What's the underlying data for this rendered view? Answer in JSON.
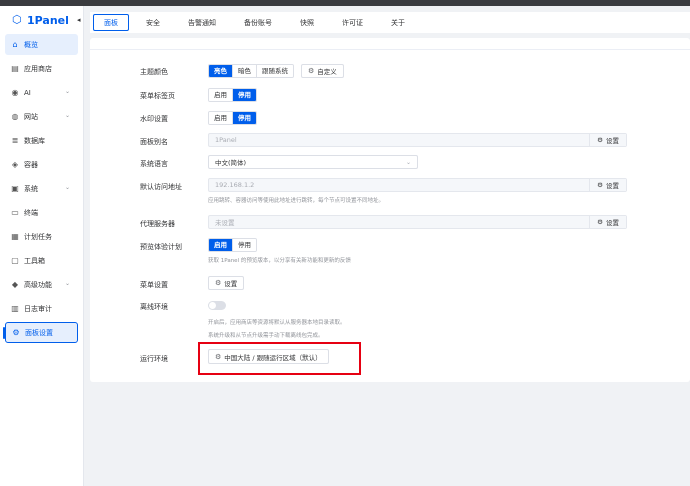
{
  "sidebar": {
    "brand": "1Panel",
    "items": [
      {
        "label": "概览",
        "icon": "home-icon",
        "expandable": false
      },
      {
        "label": "应用商店",
        "icon": "store-icon",
        "expandable": false
      },
      {
        "label": "AI",
        "icon": "robot-icon",
        "expandable": true
      },
      {
        "label": "网站",
        "icon": "globe-icon",
        "expandable": true
      },
      {
        "label": "数据库",
        "icon": "database-icon",
        "expandable": false
      },
      {
        "label": "容器",
        "icon": "container-icon",
        "expandable": false
      },
      {
        "label": "系统",
        "icon": "system-icon",
        "expandable": true
      },
      {
        "label": "终端",
        "icon": "terminal-icon",
        "expandable": false
      },
      {
        "label": "计划任务",
        "icon": "calendar-icon",
        "expandable": false
      },
      {
        "label": "工具箱",
        "icon": "toolbox-icon",
        "expandable": false
      },
      {
        "label": "高级功能",
        "icon": "diamond-icon",
        "expandable": true
      },
      {
        "label": "日志审计",
        "icon": "log-icon",
        "expandable": false
      },
      {
        "label": "面板设置",
        "icon": "gear-icon",
        "expandable": false
      }
    ]
  },
  "tabs": [
    "面板",
    "安全",
    "告警通知",
    "备份账号",
    "快照",
    "许可证",
    "关于"
  ],
  "settings": {
    "theme": {
      "label": "主题颜色",
      "options": [
        "亮色",
        "暗色",
        "跟随系统"
      ],
      "selected": "亮色",
      "custom_button": "自定义"
    },
    "menu_tab": {
      "label": "菜单标签页",
      "options": [
        "启用",
        "停用"
      ],
      "selected": "停用"
    },
    "watermark": {
      "label": "水印设置",
      "options": [
        "启用",
        "停用"
      ],
      "selected": "停用"
    },
    "panel_alias": {
      "label": "面板别名",
      "value": "1Panel",
      "button": "设置"
    },
    "language": {
      "label": "系统语言",
      "value": "中文(简体)"
    },
    "default_address": {
      "label": "默认访问地址",
      "value": "192.168.1.2",
      "button": "设置",
      "hint": "应用跳转、容器访问等使用此地址进行跳转，每个节点可设置不同地址。"
    },
    "proxy": {
      "label": "代理服务器",
      "value": "未设置",
      "button": "设置"
    },
    "preview_plan": {
      "label": "预览体验计划",
      "options": [
        "启用",
        "停用"
      ],
      "selected": "启用",
      "hint": "获取 1Panel 的预览版本，以分享有关新功能和更新的反馈"
    },
    "menu_settings": {
      "label": "菜单设置",
      "button": "设置"
    },
    "offline": {
      "label": "离线环境",
      "hint1": "开启后，应用商店等资源将默认从服务器本地目录读取。",
      "hint2": "系统升级和从节点升级需手动下载离线包完成。"
    },
    "runtime_env": {
      "label": "运行环境",
      "button": "中国大陆 / 跟随运行区域（默认）"
    }
  },
  "colors": {
    "accent": "#005eeb",
    "highlight": "#e60012"
  }
}
